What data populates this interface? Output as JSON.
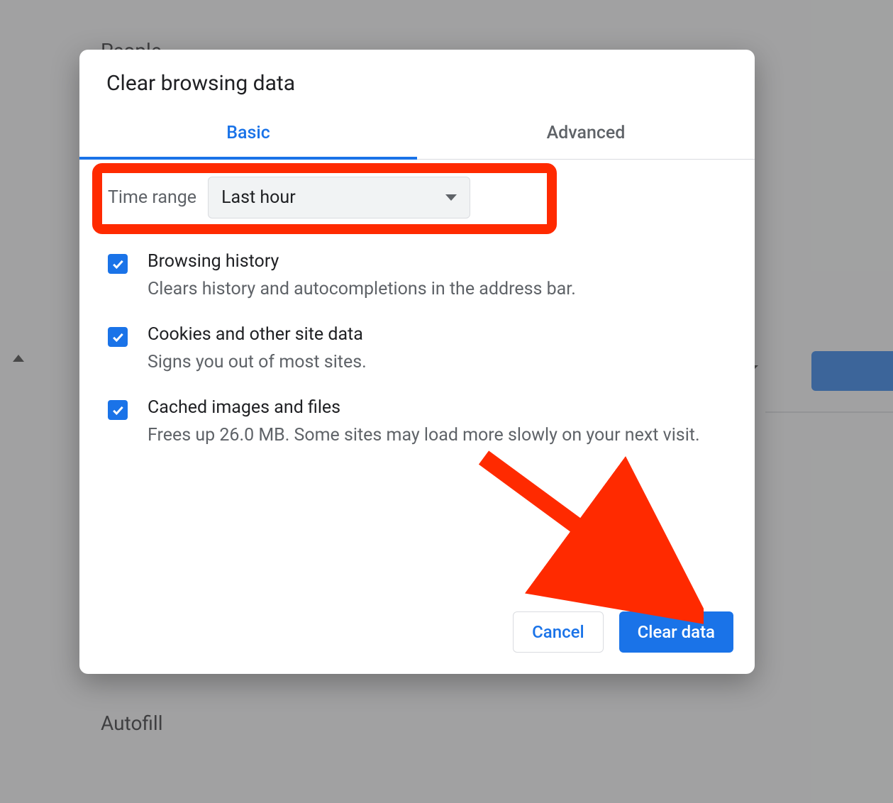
{
  "background": {
    "people": "People",
    "autofill": "Autofill"
  },
  "dialog": {
    "title": "Clear browsing data",
    "tabs": {
      "basic": "Basic",
      "advanced": "Advanced"
    },
    "time_range_label": "Time range",
    "time_range_value": "Last hour",
    "options": [
      {
        "title": "Browsing history",
        "desc": "Clears history and autocompletions in the address bar."
      },
      {
        "title": "Cookies and other site data",
        "desc": "Signs you out of most sites."
      },
      {
        "title": "Cached images and files",
        "desc": "Frees up 26.0 MB. Some sites may load more slowly on your next visit."
      }
    ],
    "buttons": {
      "cancel": "Cancel",
      "clear": "Clear data"
    }
  }
}
